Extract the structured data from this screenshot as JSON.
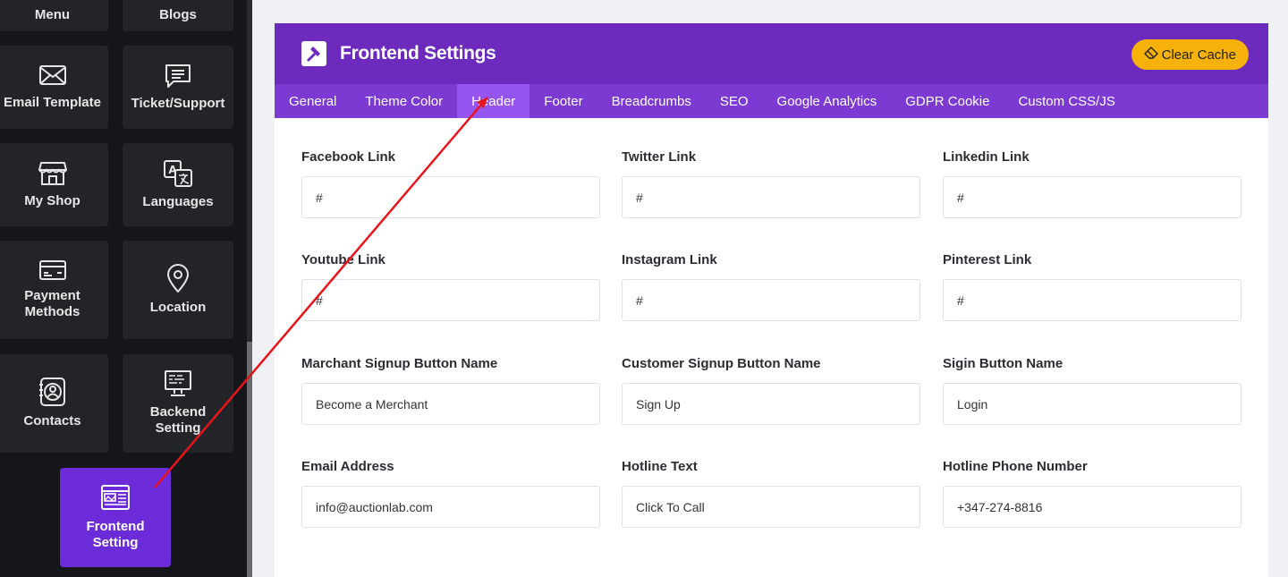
{
  "sidebar": {
    "tiles": [
      {
        "label": "Menu"
      },
      {
        "label": "Blogs"
      },
      {
        "label": "Email Template"
      },
      {
        "label": "Ticket/Support"
      },
      {
        "label": "My Shop"
      },
      {
        "label": "Languages"
      },
      {
        "label": "Payment Methods"
      },
      {
        "label": "Location"
      },
      {
        "label": "Contacts"
      },
      {
        "label": "Backend Setting"
      },
      {
        "label": "Frontend Setting"
      }
    ]
  },
  "header": {
    "title": "Frontend Settings",
    "clear_cache_label": "Clear Cache"
  },
  "tabs": [
    {
      "label": "General"
    },
    {
      "label": "Theme Color"
    },
    {
      "label": "Header",
      "active": true
    },
    {
      "label": "Footer"
    },
    {
      "label": "Breadcrumbs"
    },
    {
      "label": "SEO"
    },
    {
      "label": "Google Analytics"
    },
    {
      "label": "GDPR Cookie"
    },
    {
      "label": "Custom CSS/JS"
    }
  ],
  "fields": [
    {
      "label": "Facebook Link",
      "value": "#"
    },
    {
      "label": "Twitter Link",
      "value": "#"
    },
    {
      "label": "Linkedin Link",
      "value": "#"
    },
    {
      "label": "Youtube Link",
      "value": "#"
    },
    {
      "label": "Instagram Link",
      "value": "#"
    },
    {
      "label": "Pinterest Link",
      "value": "#"
    },
    {
      "label": "Marchant Signup Button Name",
      "value": "Become a Merchant"
    },
    {
      "label": "Customer Signup Button Name",
      "value": "Sign Up"
    },
    {
      "label": "Sigin Button Name",
      "value": "Login"
    },
    {
      "label": "Email Address",
      "value": "info@auctionlab.com"
    },
    {
      "label": "Hotline Text",
      "value": "Click To Call"
    },
    {
      "label": "Hotline Phone Number",
      "value": "+347-274-8816"
    }
  ],
  "colors": {
    "sidebar_bg": "#151619",
    "tile_bg": "#232428",
    "accent": "#6c2bbd",
    "tab_bar": "#7c3ad3",
    "tab_active": "#9655f0",
    "cache_button": "#f6b20b",
    "annotation_arrow": "#e8141c"
  }
}
